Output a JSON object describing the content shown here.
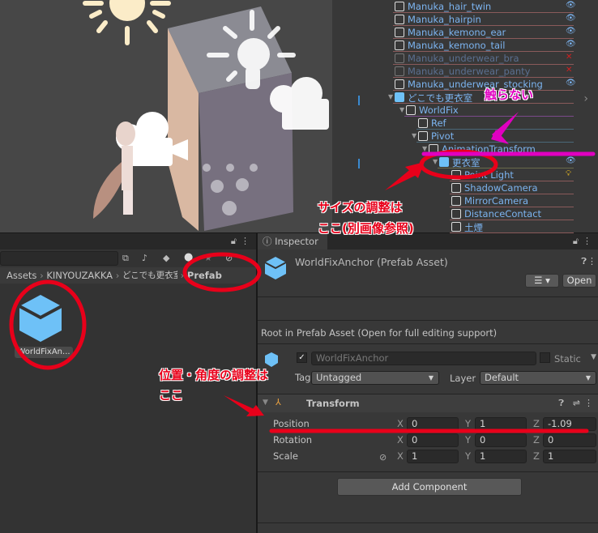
{
  "hierarchy": {
    "items": [
      {
        "label": "Manuka_hair_twin",
        "dim": false
      },
      {
        "label": "Manuka_hairpin",
        "dim": false
      },
      {
        "label": "Manuka_kemono_ear",
        "dim": false
      },
      {
        "label": "Manuka_kemono_tail",
        "dim": false
      },
      {
        "label": "Manuka_underwear_bra",
        "dim": true
      },
      {
        "label": "Manuka_underwear_panty",
        "dim": true
      },
      {
        "label": "Manuka_underwear_stocking",
        "dim": false
      },
      {
        "label": "どこでも更衣室",
        "dim": false
      },
      {
        "label": "WorldFix",
        "dim": false
      },
      {
        "label": "Ref",
        "dim": false
      },
      {
        "label": "Pivot",
        "dim": false
      },
      {
        "label": "AnimationTransform",
        "dim": false
      },
      {
        "label": "更衣室",
        "dim": false
      },
      {
        "label": "Point Light",
        "dim": false
      },
      {
        "label": "ShadowCamera",
        "dim": false
      },
      {
        "label": "MirrorCamera",
        "dim": false
      },
      {
        "label": "DistanceContact",
        "dim": false
      },
      {
        "label": "土煙",
        "dim": false
      }
    ]
  },
  "project": {
    "breadcrumb": [
      "Assets",
      "KINYOUZAKKA",
      "どこでも更衣室",
      "Prefab"
    ],
    "asset_label": "WorldFixAn..."
  },
  "inspector": {
    "tab": "Inspector",
    "title": "WorldFixAnchor (Prefab Asset)",
    "open_label": "Open",
    "root_note": "Root in Prefab Asset (Open for full editing support)",
    "name_value": "WorldFixAnchor",
    "static_label": "Static",
    "tag_label": "Tag",
    "tag_value": "Untagged",
    "layer_label": "Layer",
    "layer_value": "Default",
    "transform": {
      "title": "Transform",
      "rows": [
        {
          "label": "Position",
          "x": "0",
          "y": "1",
          "z": "-1.09"
        },
        {
          "label": "Rotation",
          "x": "0",
          "y": "0",
          "z": "0"
        },
        {
          "label": "Scale",
          "x": "1",
          "y": "1",
          "z": "1"
        }
      ],
      "axis": [
        "X",
        "Y",
        "Z"
      ]
    },
    "add_component": "Add Component"
  },
  "annotations": {
    "dont_touch": "触らない",
    "size_line1": "サイズの調整は",
    "size_line2": "ここ(別画像参照)",
    "pos_line1": "位置・角度の調整は",
    "pos_line2": "ここ"
  },
  "colors": {
    "accent": "#7cb4f0",
    "annotation_red": "#e8001a",
    "annotation_magenta": "#e000c0"
  }
}
